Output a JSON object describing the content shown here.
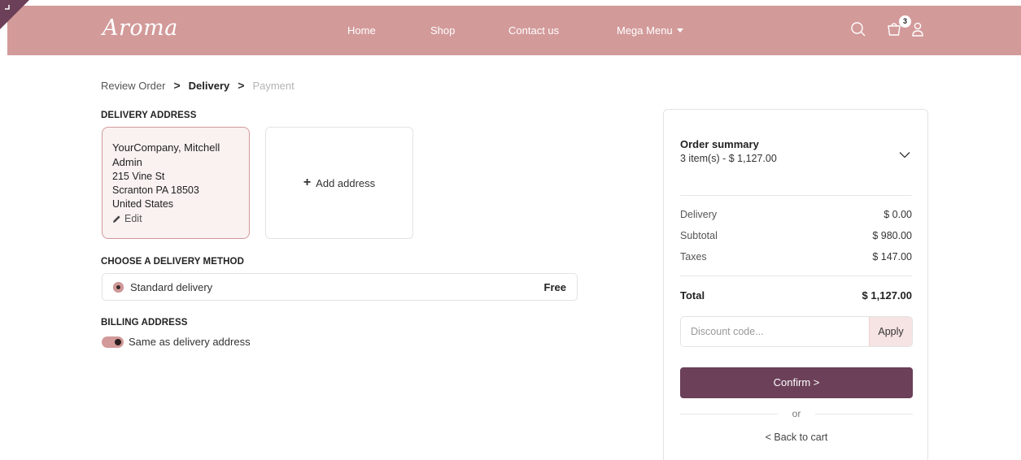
{
  "nav": {
    "brand": "Aroma",
    "links": [
      "Home",
      "Shop",
      "Contact us",
      "Mega Menu"
    ],
    "cart_count": "3",
    "bar_color": "#d39a9a"
  },
  "breadcrumb": {
    "step1": "Review Order",
    "step2": "Delivery",
    "step3": "Payment",
    "separator": ">"
  },
  "delivery": {
    "title": "DELIVERY ADDRESS",
    "address": {
      "name": "YourCompany, Mitchell Admin",
      "street": "215 Vine St",
      "city": "Scranton PA 18503",
      "country": "United States",
      "edit_label": "Edit"
    },
    "add_label": "Add address"
  },
  "method": {
    "title": "CHOOSE A DELIVERY METHOD",
    "name": "Standard delivery",
    "price": "Free"
  },
  "billing": {
    "title": "BILLING ADDRESS",
    "same_label": "Same as delivery address"
  },
  "summary": {
    "title": "Order summary",
    "count": "3 item(s) -  $ 1,127.00",
    "delivery_label": "Delivery",
    "delivery_value": "$ 0.00",
    "subtotal_label": "Subtotal",
    "subtotal_value": "$ 980.00",
    "taxes_label": "Taxes",
    "taxes_value": "$ 147.00",
    "total_label": "Total",
    "total_value": "$ 1,127.00",
    "discount_placeholder": "Discount code...",
    "apply_label": "Apply",
    "confirm_label": "Confirm  >",
    "or_label": "or",
    "back_label": "<  Back to cart",
    "accent": "#6b4058"
  }
}
